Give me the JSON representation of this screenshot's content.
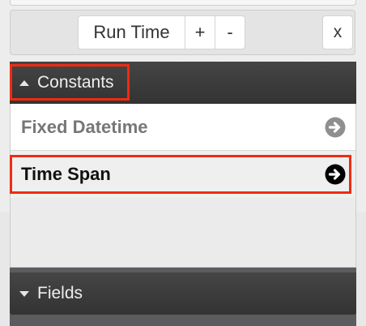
{
  "toolbar": {
    "run_time_label": "Run Time",
    "plus_label": "+",
    "minus_label": "-",
    "close_label": "x"
  },
  "constants_section": {
    "title": "Constants",
    "expanded": true,
    "items": [
      {
        "label": "Fixed Datetime",
        "icon": "arrow-right-circle-icon",
        "selected": false
      },
      {
        "label": "Time Span",
        "icon": "arrow-right-circle-icon",
        "selected": true
      }
    ]
  },
  "fields_section": {
    "title": "Fields",
    "expanded": false
  },
  "colors": {
    "highlight": "#ee2c10",
    "section_header": "#3d3d3d"
  }
}
